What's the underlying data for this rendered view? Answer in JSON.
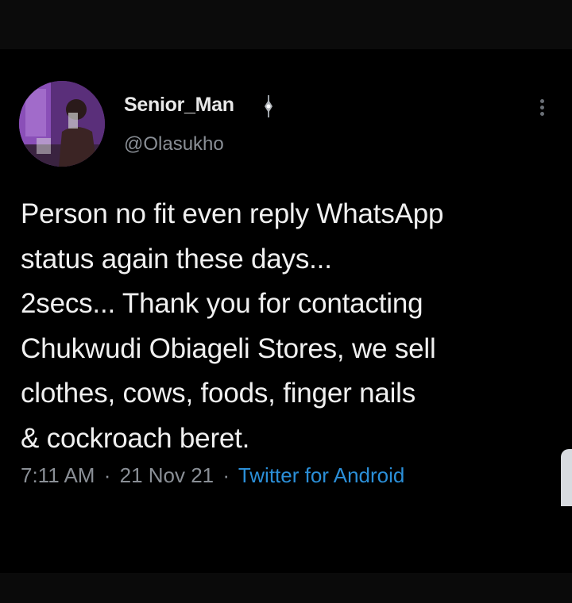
{
  "tweet": {
    "display_name": "Senior_Man",
    "handle": "@Olasukho",
    "text_lines": [
      "Person no fit even reply WhatsApp",
      "status again these days...",
      "2secs... Thank you for contacting",
      "Chukwudi Obiageli Stores, we sell",
      "clothes, cows, foods, finger nails",
      "& cockroach beret."
    ],
    "time": "7:11 AM",
    "date": "21 Nov 21",
    "source": "Twitter for Android",
    "separator": "·"
  },
  "icons": {
    "badge": "badge-icon",
    "more": "more-options-icon",
    "avatar": "avatar"
  },
  "colors": {
    "background": "#000000",
    "text": "#f0f0f0",
    "muted": "#8a8f96",
    "link": "#2b8fd8"
  }
}
